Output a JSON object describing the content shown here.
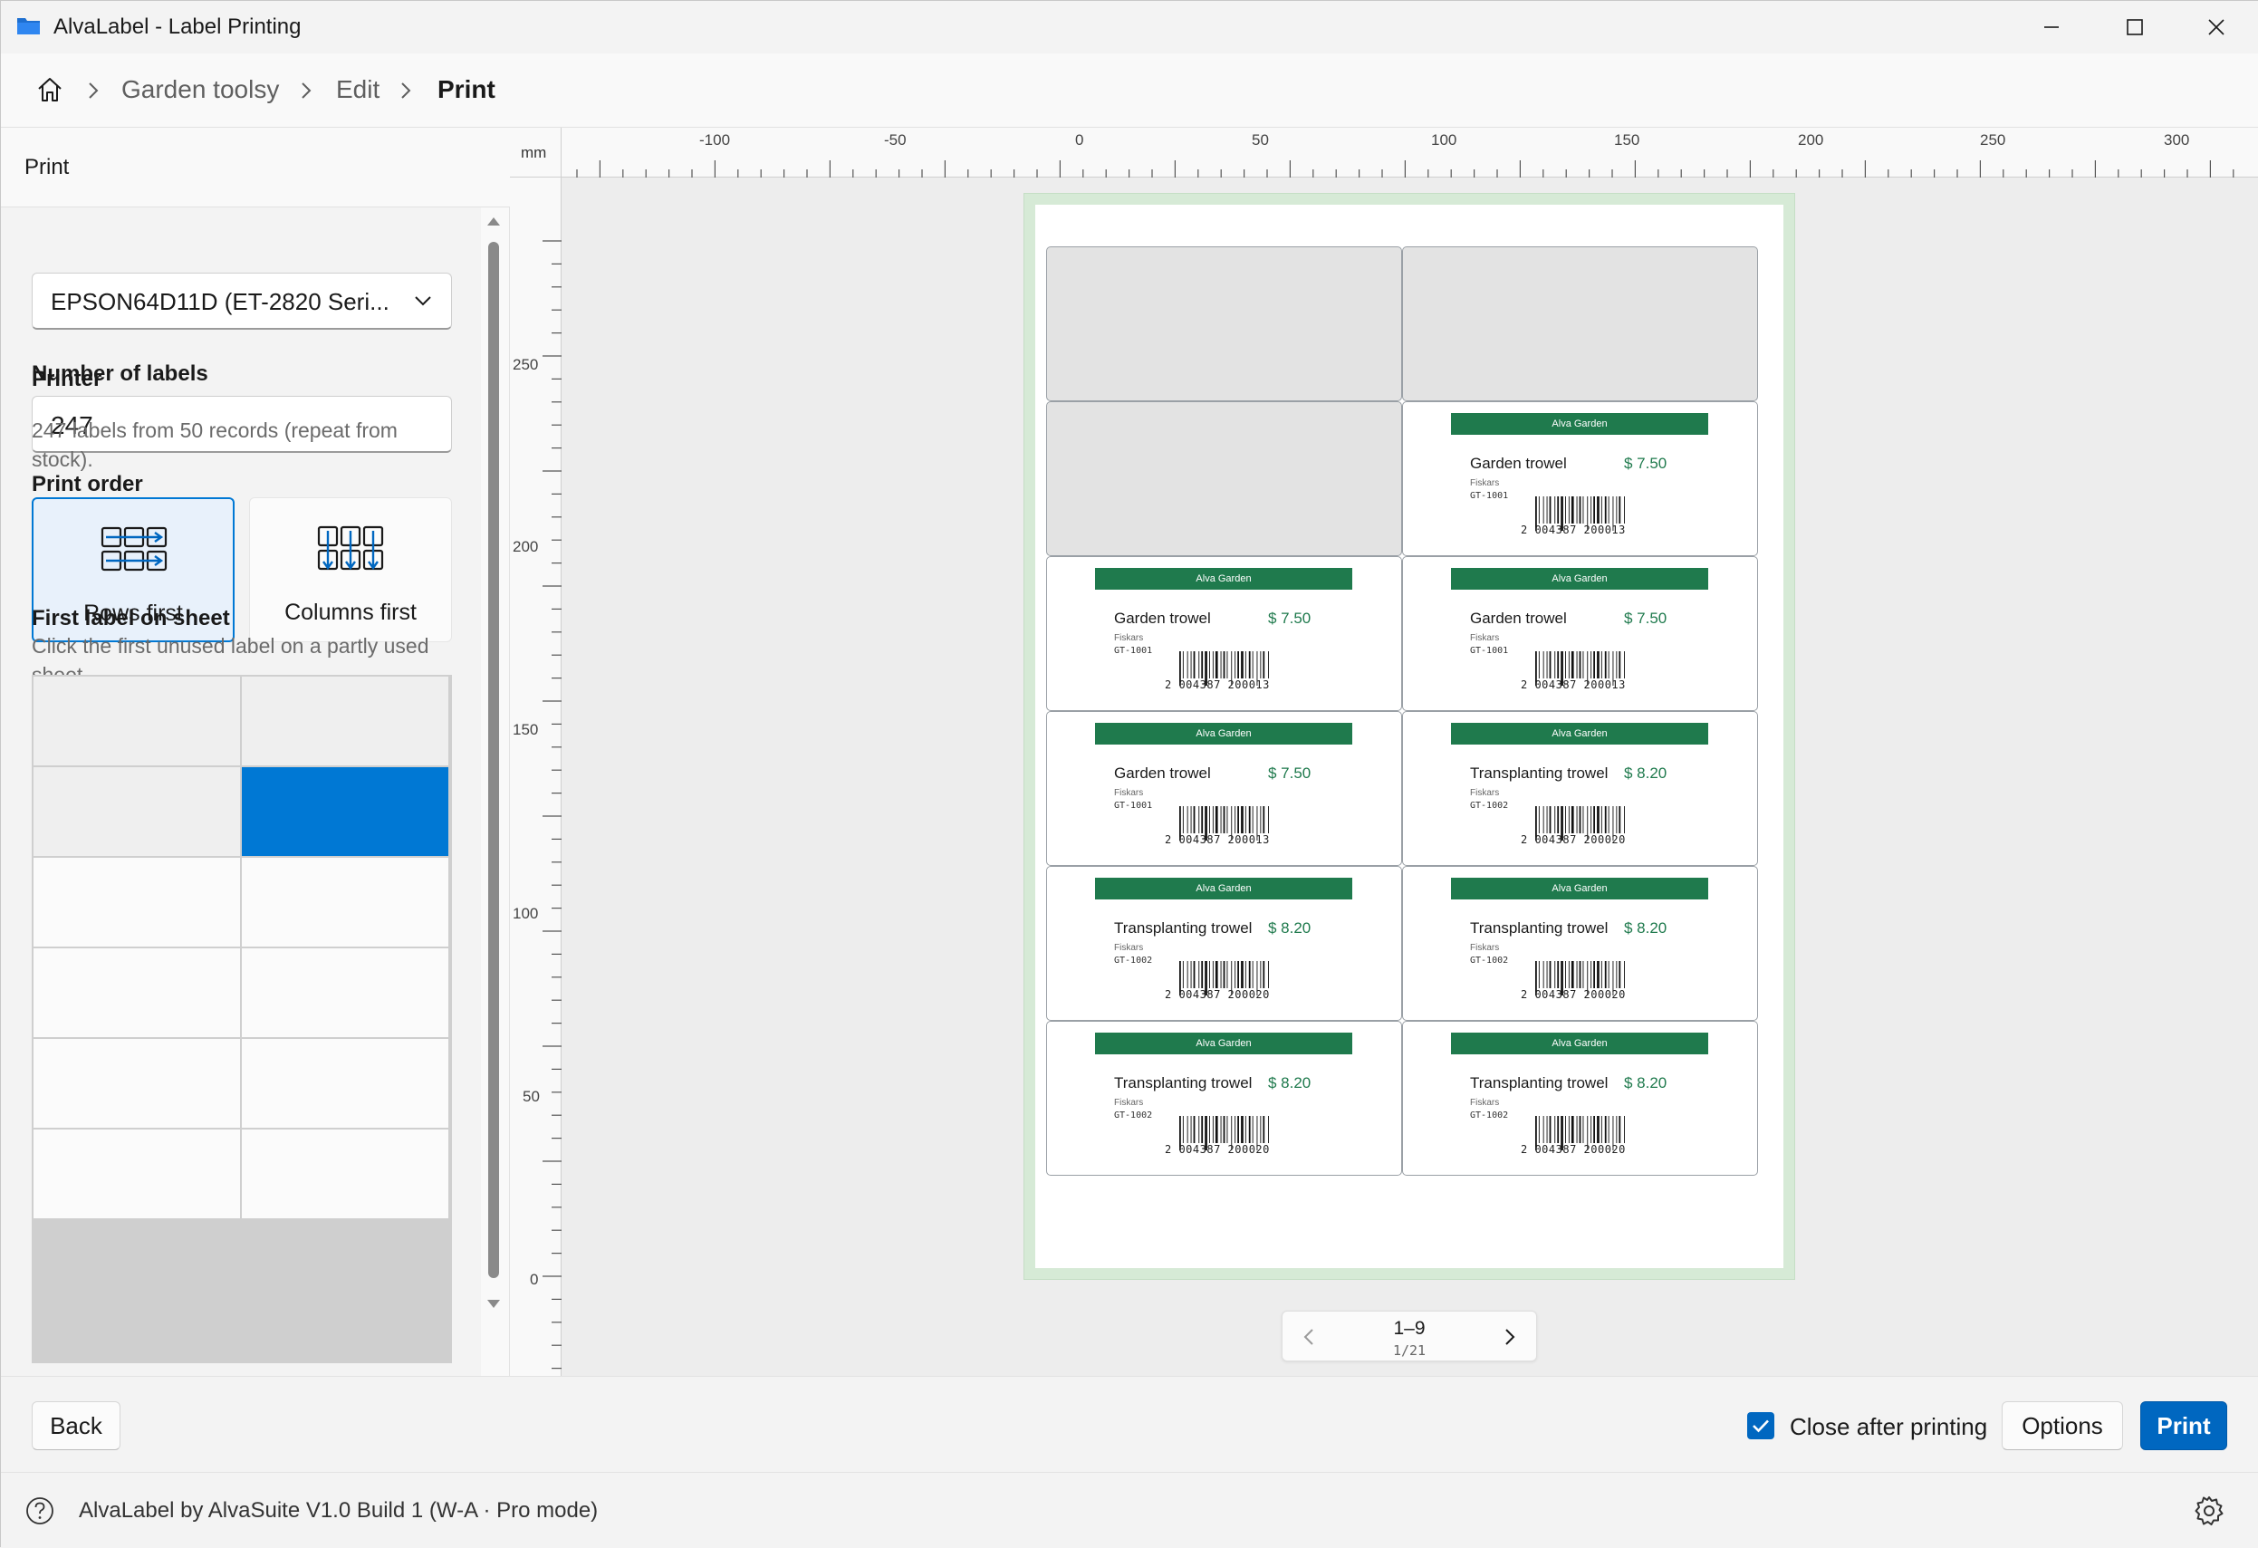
{
  "window": {
    "title": "AlvaLabel - Label Printing"
  },
  "breadcrumb": {
    "items": [
      "Garden toolsy",
      "Edit",
      "Print"
    ]
  },
  "panel": {
    "title": "Print",
    "printer_label": "Printer",
    "printer_value": "EPSON64D11D (ET-2820 Seri...",
    "count_label": "Number of labels",
    "count_value": "247",
    "count_hint": "247 labels from 50 records (repeat from stock).",
    "order_label": "Print order",
    "order_rows": "Rows first",
    "order_cols": "Columns first",
    "first_label_title": "First label on sheet",
    "first_label_hint": "Click the first unused label on a partly used sheet."
  },
  "ruler": {
    "unit": "mm",
    "x_ticks": [
      "-100",
      "-50",
      "0",
      "50",
      "100",
      "150",
      "200",
      "250",
      "300"
    ],
    "y_ticks": [
      "250",
      "200",
      "150",
      "100",
      "50",
      "0"
    ]
  },
  "labels": [
    {
      "used": true
    },
    {
      "used": true
    },
    {
      "used": true
    },
    {
      "used": false,
      "band": "Alva Garden",
      "name": "Garden trowel",
      "price": "$ 7.50",
      "brand": "Fiskars",
      "sku": "GT-1001",
      "barcode": "2 004387 200013"
    },
    {
      "used": false,
      "band": "Alva Garden",
      "name": "Garden trowel",
      "price": "$ 7.50",
      "brand": "Fiskars",
      "sku": "GT-1001",
      "barcode": "2 004387 200013"
    },
    {
      "used": false,
      "band": "Alva Garden",
      "name": "Garden trowel",
      "price": "$ 7.50",
      "brand": "Fiskars",
      "sku": "GT-1001",
      "barcode": "2 004387 200013"
    },
    {
      "used": false,
      "band": "Alva Garden",
      "name": "Garden trowel",
      "price": "$ 7.50",
      "brand": "Fiskars",
      "sku": "GT-1001",
      "barcode": "2 004387 200013"
    },
    {
      "used": false,
      "band": "Alva Garden",
      "name": "Transplanting trowel",
      "price": "$ 8.20",
      "brand": "Fiskars",
      "sku": "GT-1002",
      "barcode": "2 004387 200020"
    },
    {
      "used": false,
      "band": "Alva Garden",
      "name": "Transplanting trowel",
      "price": "$ 8.20",
      "brand": "Fiskars",
      "sku": "GT-1002",
      "barcode": "2 004387 200020"
    },
    {
      "used": false,
      "band": "Alva Garden",
      "name": "Transplanting trowel",
      "price": "$ 8.20",
      "brand": "Fiskars",
      "sku": "GT-1002",
      "barcode": "2 004387 200020"
    },
    {
      "used": false,
      "band": "Alva Garden",
      "name": "Transplanting trowel",
      "price": "$ 8.20",
      "brand": "Fiskars",
      "sku": "GT-1002",
      "barcode": "2 004387 200020"
    },
    {
      "used": false,
      "band": "Alva Garden",
      "name": "Transplanting trowel",
      "price": "$ 8.20",
      "brand": "Fiskars",
      "sku": "GT-1002",
      "barcode": "2 004387 200020"
    }
  ],
  "pager": {
    "range": "1–9",
    "page": "1/21"
  },
  "footer": {
    "back": "Back",
    "close_after": "Close after printing",
    "close_after_checked": true,
    "options": "Options",
    "print": "Print"
  },
  "status": {
    "text": "AlvaLabel by AlvaSuite V1.0 Build 1 (W-A · Pro mode)"
  },
  "colors": {
    "accent": "#0067c0",
    "brand_green": "#1f7a4d"
  }
}
